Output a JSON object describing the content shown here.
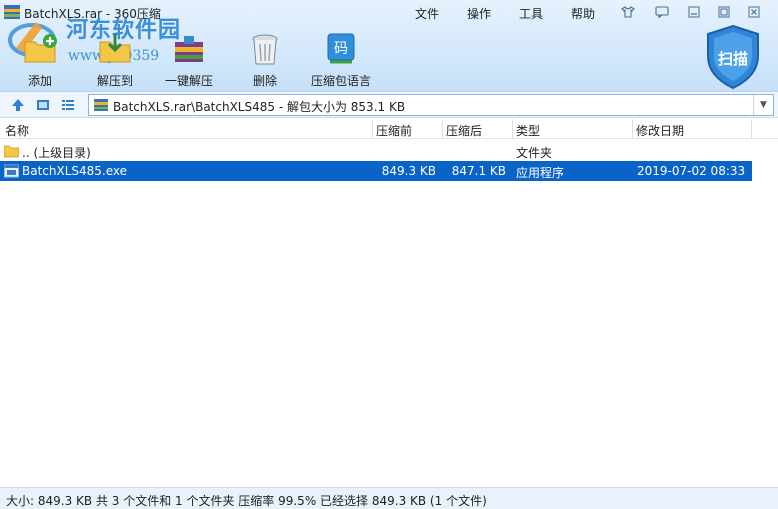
{
  "window": {
    "title": "BatchXLS.rar - 360压缩"
  },
  "watermark": {
    "brand": "河东软件园",
    "url": "www.pc0359"
  },
  "menu": {
    "file": "文件",
    "operation": "操作",
    "tools": "工具",
    "help": "帮助"
  },
  "toolbar": {
    "add": "添加",
    "extract_to": "解压到",
    "one_click_extract": "一键解压",
    "delete": "删除",
    "archive_language": "压缩包语言",
    "scan": "扫描"
  },
  "address": {
    "path": "BatchXLS.rar\\BatchXLS485 - 解包大小为 853.1 KB"
  },
  "table": {
    "columns": {
      "name": "名称",
      "compressed_before": "压缩前",
      "compressed_after": "压缩后",
      "type": "类型",
      "modified": "修改日期"
    },
    "rows": [
      {
        "name": ".. (上级目录)",
        "before": "",
        "after": "",
        "type": "文件夹",
        "modified": ""
      },
      {
        "name": "BatchXLS485.exe",
        "before": "849.3 KB",
        "after": "847.1 KB",
        "type": "应用程序",
        "modified": "2019-07-02 08:33"
      }
    ]
  },
  "status": {
    "text": "大小: 849.3 KB 共 3 个文件和 1 个文件夹 压缩率 99.5% 已经选择 849.3 KB (1 个文件)"
  },
  "colors": {
    "selection": "#0a64c8",
    "toolbar_bg": "#d3e8fb",
    "scan_shield": "#2f86d9",
    "watermark": "#3b8fd6"
  }
}
